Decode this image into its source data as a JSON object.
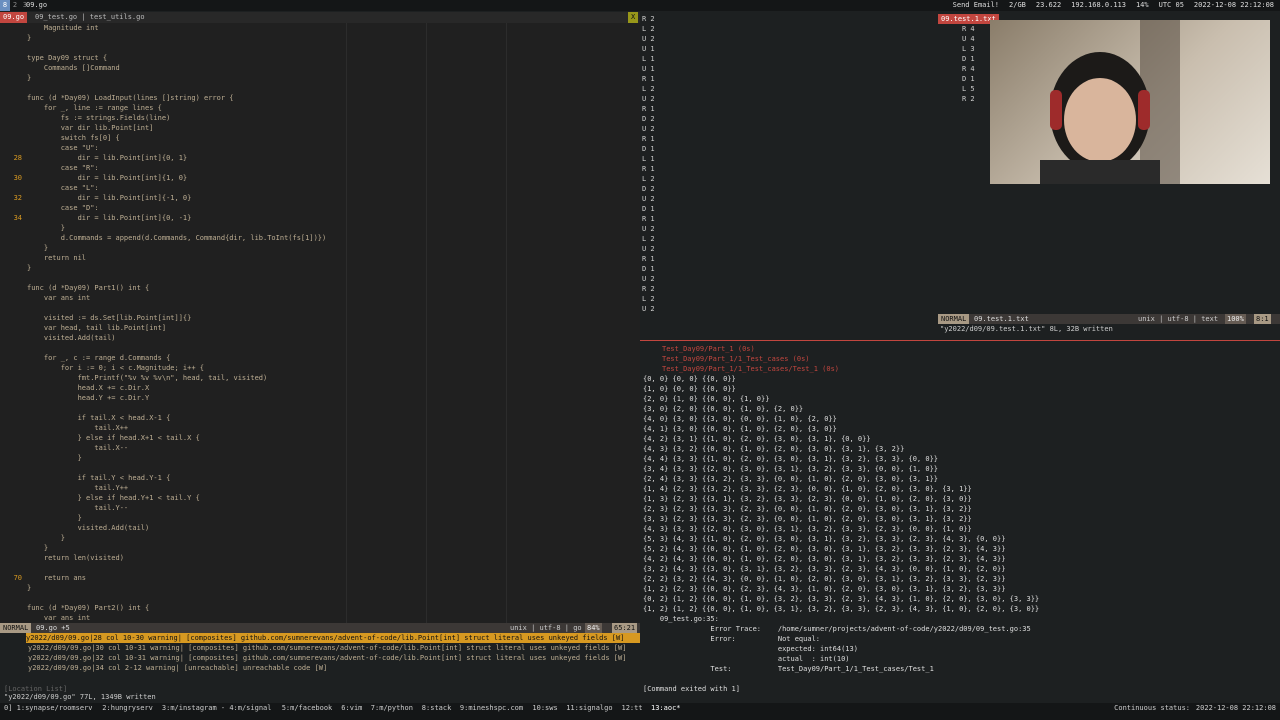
{
  "topbar": {
    "workspaces": [
      "8",
      "2",
      "3"
    ],
    "title": "09.go",
    "sys": [
      "Send Email!",
      "2/GB",
      "23.622",
      "192.168.0.113",
      "14%",
      "UTC 05",
      "2022-12-08 22:12:08"
    ]
  },
  "tabline": {
    "active": "09.go",
    "others": "09_test.go | test_utils.go",
    "close": "X"
  },
  "editor": {
    "lines": [
      {
        "n": "",
        "t": "    Magnitude int",
        "w": false
      },
      {
        "n": "",
        "t": "}",
        "w": false
      },
      {
        "n": "",
        "t": "",
        "w": false
      },
      {
        "n": "",
        "t": "type Day09 struct {",
        "w": false
      },
      {
        "n": "",
        "t": "    Commands []Command",
        "w": false
      },
      {
        "n": "",
        "t": "}",
        "w": false
      },
      {
        "n": "",
        "t": "",
        "w": false
      },
      {
        "n": "",
        "t": "func (d *Day09) LoadInput(lines []string) error {",
        "w": false
      },
      {
        "n": "",
        "t": "    for _, line := range lines {",
        "w": false
      },
      {
        "n": "",
        "t": "        fs := strings.Fields(line)",
        "w": false
      },
      {
        "n": "",
        "t": "        var dir lib.Point[int]",
        "w": false
      },
      {
        "n": "",
        "t": "        switch fs[0] {",
        "w": false
      },
      {
        "n": "",
        "t": "        case \"U\":",
        "w": false
      },
      {
        "n": "28",
        "t": "            dir = lib.Point[int]{0, 1}",
        "w": true
      },
      {
        "n": "",
        "t": "        case \"R\":",
        "w": false
      },
      {
        "n": "30",
        "t": "            dir = lib.Point[int]{1, 0}",
        "w": true
      },
      {
        "n": "",
        "t": "        case \"L\":",
        "w": false
      },
      {
        "n": "32",
        "t": "            dir = lib.Point[int]{-1, 0}",
        "w": true
      },
      {
        "n": "",
        "t": "        case \"D\":",
        "w": false
      },
      {
        "n": "34",
        "t": "            dir = lib.Point[int]{0, -1}",
        "w": true
      },
      {
        "n": "",
        "t": "        }",
        "w": false
      },
      {
        "n": "",
        "t": "        d.Commands = append(d.Commands, Command{dir, lib.ToInt(fs[1])})",
        "w": false
      },
      {
        "n": "",
        "t": "    }",
        "w": false
      },
      {
        "n": "",
        "t": "    return nil",
        "w": false
      },
      {
        "n": "",
        "t": "}",
        "w": false
      },
      {
        "n": "",
        "t": "",
        "w": false
      },
      {
        "n": "",
        "t": "func (d *Day09) Part1() int {",
        "w": false
      },
      {
        "n": "",
        "t": "    var ans int",
        "w": false
      },
      {
        "n": "",
        "t": "",
        "w": false
      },
      {
        "n": "",
        "t": "    visited := ds.Set[lib.Point[int]]{}",
        "w": false
      },
      {
        "n": "",
        "t": "    var head, tail lib.Point[int]",
        "w": false
      },
      {
        "n": "",
        "t": "    visited.Add(tail)",
        "w": false
      },
      {
        "n": "",
        "t": "",
        "w": false
      },
      {
        "n": "",
        "t": "    for _, c := range d.Commands {",
        "w": false
      },
      {
        "n": "",
        "t": "        for i := 0; i < c.Magnitude; i++ {",
        "w": false
      },
      {
        "n": "",
        "t": "            fmt.Printf(\"%v %v %v\\n\", head, tail, visited)",
        "w": false
      },
      {
        "n": "",
        "t": "            head.X += c.Dir.X",
        "w": false
      },
      {
        "n": "",
        "t": "            head.Y += c.Dir.Y",
        "w": false
      },
      {
        "n": "",
        "t": "",
        "w": false
      },
      {
        "n": "",
        "t": "            if tail.X < head.X-1 {",
        "w": false
      },
      {
        "n": "",
        "t": "                tail.X++",
        "w": false
      },
      {
        "n": "",
        "t": "            } else if head.X+1 < tail.X {",
        "w": false
      },
      {
        "n": "",
        "t": "                tail.X--",
        "w": false
      },
      {
        "n": "",
        "t": "            }",
        "w": false
      },
      {
        "n": "",
        "t": "",
        "w": false
      },
      {
        "n": "",
        "t": "            if tail.Y < head.Y-1 {",
        "w": false
      },
      {
        "n": "",
        "t": "                tail.Y++",
        "w": false
      },
      {
        "n": "",
        "t": "            } else if head.Y+1 < tail.Y {",
        "w": false
      },
      {
        "n": "",
        "t": "                tail.Y--",
        "w": false
      },
      {
        "n": "",
        "t": "            }",
        "w": false
      },
      {
        "n": "",
        "t": "            visited.Add(tail)",
        "w": false
      },
      {
        "n": "",
        "t": "        }",
        "w": false
      },
      {
        "n": "",
        "t": "    }",
        "w": false
      },
      {
        "n": "",
        "t": "    return len(visited)",
        "w": false
      },
      {
        "n": "",
        "t": "",
        "w": false
      },
      {
        "n": "70",
        "t": "    return ans",
        "w": true
      },
      {
        "n": "",
        "t": "}",
        "w": false
      },
      {
        "n": "",
        "t": "",
        "w": false
      },
      {
        "n": "",
        "t": "func (d *Day09) Part2() int {",
        "w": false
      },
      {
        "n": "",
        "t": "    var ans int",
        "w": false
      }
    ]
  },
  "statusL": {
    "mode": "NORMAL",
    "file": "09.go +5",
    "info": "unix | utf-8 | go",
    "pct": "84%",
    "pos": "65:21"
  },
  "quickfix": [
    "y2022/d09/09.go|28 col 10-30 warning| [composites] github.com/sumnerevans/advent-of-code/lib.Point[int] struct literal uses unkeyed fields [W]",
    "y2022/d09/09.go|30 col 10-31 warning| [composites] github.com/sumnerevans/advent-of-code/lib.Point[int] struct literal uses unkeyed fields [W]",
    "y2022/d09/09.go|32 col 10-31 warning| [composites] github.com/sumnerevans/advent-of-code/lib.Point[int] struct literal uses unkeyed fields [W]",
    "y2022/d09/09.go|34 col 2-12 warning| [unreachable] unreachable code [W]"
  ],
  "qfLabel": "[Location List]",
  "cmdline": "\"y2022/d09/09.go\" 77L, 1349B written",
  "inputLines": [
    "R 2",
    "L 2",
    "U 2",
    "U 1",
    "L 1",
    "U 1",
    "R 1",
    "L 2",
    "U 2",
    "R 1",
    "D 2",
    "U 2",
    "R 1",
    "D 1",
    "L 1",
    "R 1",
    "L 2",
    "D 2",
    "U 2",
    "D 1",
    "R 1",
    "U 2",
    "L 2",
    "U 2",
    "R 1",
    "D 1",
    "U 2",
    "R 2",
    "L 2",
    "U 2"
  ],
  "rightFile": {
    "title": "09.test.1.txt",
    "lines": [
      "R 4",
      "U 4",
      "L 3",
      "D 1",
      "R 4",
      "D 1",
      "L 5",
      "R 2"
    ],
    "mode": "NORMAL",
    "name": "09.test.1.txt",
    "info": "unix | utf-8 | text",
    "pct": "100%",
    "pos": "8:1",
    "msg": "\"y2022/d09/09.test.1.txt\" 8L, 32B written"
  },
  "tests": [
    "Test_Day09/Part_1 (0s)",
    "Test_Day09/Part_1/1_Test_cases (0s)",
    "Test_Day09/Part_1/1_Test_cases/Test_1 (0s)"
  ],
  "output": [
    "{0, 0} {0, 0} {{0, 0}}",
    "{1, 0} {0, 0} {{0, 0}}",
    "{2, 0} {1, 0} {{0, 0}, {1, 0}}",
    "{3, 0} {2, 0} {{0, 0}, {1, 0}, {2, 0}}",
    "{4, 0} {3, 0} {{3, 0}, {0, 0}, {1, 0}, {2, 0}}",
    "{4, 1} {3, 0} {{0, 0}, {1, 0}, {2, 0}, {3, 0}}",
    "{4, 2} {3, 1} {{1, 0}, {2, 0}, {3, 0}, {3, 1}, {0, 0}}",
    "{4, 3} {3, 2} {{0, 0}, {1, 0}, {2, 0}, {3, 0}, {3, 1}, {3, 2}}",
    "{4, 4} {3, 3} {{1, 0}, {2, 0}, {3, 0}, {3, 1}, {3, 2}, {3, 3}, {0, 0}}",
    "{3, 4} {3, 3} {{2, 0}, {3, 0}, {3, 1}, {3, 2}, {3, 3}, {0, 0}, {1, 0}}",
    "{2, 4} {3, 3} {{3, 2}, {3, 3}, {0, 0}, {1, 0}, {2, 0}, {3, 0}, {3, 1}}",
    "{1, 4} {2, 3} {{3, 2}, {3, 3}, {2, 3}, {0, 0}, {1, 0}, {2, 0}, {3, 0}, {3, 1}}",
    "{1, 3} {2, 3} {{3, 1}, {3, 2}, {3, 3}, {2, 3}, {0, 0}, {1, 0}, {2, 0}, {3, 0}}",
    "{2, 3} {2, 3} {{3, 3}, {2, 3}, {0, 0}, {1, 0}, {2, 0}, {3, 0}, {3, 1}, {3, 2}}",
    "{3, 3} {2, 3} {{3, 3}, {2, 3}, {0, 0}, {1, 0}, {2, 0}, {3, 0}, {3, 1}, {3, 2}}",
    "{4, 3} {3, 3} {{2, 0}, {3, 0}, {3, 1}, {3, 2}, {3, 3}, {2, 3}, {0, 0}, {1, 0}}",
    "{5, 3} {4, 3} {{1, 0}, {2, 0}, {3, 0}, {3, 1}, {3, 2}, {3, 3}, {2, 3}, {4, 3}, {0, 0}}",
    "{5, 2} {4, 3} {{0, 0}, {1, 0}, {2, 0}, {3, 0}, {3, 1}, {3, 2}, {3, 3}, {2, 3}, {4, 3}}",
    "{4, 2} {4, 3} {{0, 0}, {1, 0}, {2, 0}, {3, 0}, {3, 1}, {3, 2}, {3, 3}, {2, 3}, {4, 3}}",
    "{3, 2} {4, 3} {{3, 0}, {3, 1}, {3, 2}, {3, 3}, {2, 3}, {4, 3}, {0, 0}, {1, 0}, {2, 0}}",
    "{2, 2} {3, 2} {{4, 3}, {0, 0}, {1, 0}, {2, 0}, {3, 0}, {3, 1}, {3, 2}, {3, 3}, {2, 3}}",
    "{1, 2} {2, 3} {{0, 0}, {2, 3}, {4, 3}, {1, 0}, {2, 0}, {3, 0}, {3, 1}, {3, 2}, {3, 3}}",
    "{0, 2} {1, 2} {{0, 0}, {1, 0}, {3, 2}, {3, 3}, {2, 3}, {4, 3}, {1, 0}, {2, 0}, {3, 0}, {3, 3}}",
    "{1, 2} {1, 2} {{0, 0}, {1, 0}, {3, 1}, {3, 2}, {3, 3}, {2, 3}, {4, 3}, {1, 0}, {2, 0}, {3, 0}}",
    "    09_test.go:35:",
    "                Error Trace:    /home/sumner/projects/advent-of-code/y2022/d09/09_test.go:35",
    "                Error:          Not equal:",
    "                                expected: int64(13)",
    "                                actual  : int(10)",
    "                Test:           Test_Day09/Part_1/1_Test_cases/Test_1"
  ],
  "exited": "[Command exited with 1]",
  "bottombar": {
    "workspaces": [
      "0] 1:synapse/roomserv",
      "2:hungryserv",
      "3:m/instagram - 4:m/signal",
      "5:m/facebook",
      "6:vim",
      "7:m/python",
      "8:stack",
      "9:mineshspc.com",
      "10:sws",
      "11:signalgo",
      "12:tt",
      "13:aoc*"
    ],
    "status": "Continuous status:",
    "time": "2022-12-08 22:12:08"
  }
}
